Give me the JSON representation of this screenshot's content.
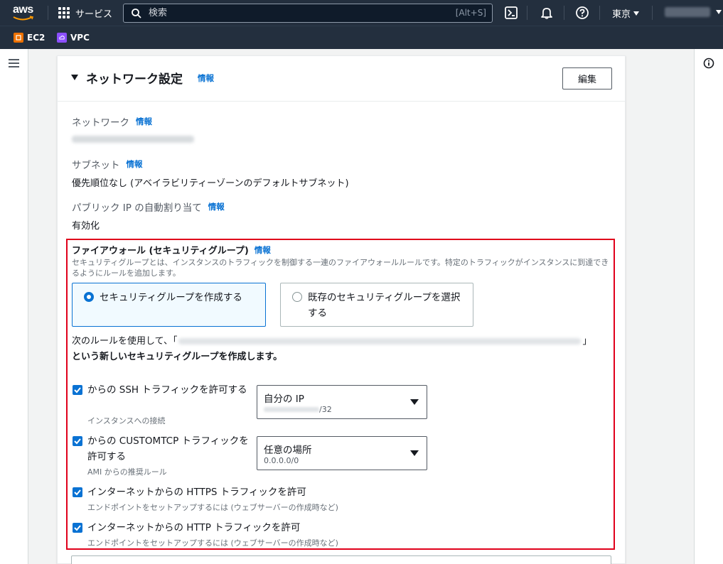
{
  "topnav": {
    "logo_text": "aws",
    "services_label": "サービス",
    "search_placeholder": "検索",
    "search_shortcut": "[Alt+S]",
    "region_label": "東京"
  },
  "favorites": [
    {
      "label": "EC2",
      "color": "#ed7100"
    },
    {
      "label": "VPC",
      "color": "#8c4fff"
    }
  ],
  "panel": {
    "title": "ネットワーク設定",
    "info_label": "情報",
    "edit_label": "編集",
    "fields": {
      "network_label": "ネットワーク",
      "subnet_label": "サブネット",
      "subnet_value": "優先順位なし (アベイラビリティーゾーンのデフォルトサブネット)",
      "public_ip_label": "パブリック IP の自動割り当て",
      "public_ip_value": "有効化"
    },
    "firewall": {
      "title": "ファイアウォール (セキュリティグループ)",
      "description": "セキュリティグループとは、インスタンスのトラフィックを制御する一連のファイアウォールルールです。特定のトラフィックがインスタンスに到達できるようにルールを追加します。",
      "option_create": "セキュリティグループを作成する",
      "option_existing": "既存のセキュリティグループを選択する",
      "rule_prefix": "次のルールを使用して、「",
      "rule_suffix": "」",
      "rule_line2": "という新しいセキュリティグループを作成します。",
      "rules": [
        {
          "label": "からの SSH トラフィックを許可する",
          "sub": "インスタンスへの接続",
          "select_main": "自分の IP",
          "select_sub": "/32"
        },
        {
          "label": "からの CUSTOMTCP トラフィックを許可する",
          "sub": "AMI からの推奨ルール",
          "select_main": "任意の場所",
          "select_sub": "0.0.0.0/0"
        },
        {
          "label": "インターネットからの HTTPS トラフィックを許可",
          "sub": "エンドポイントをセットアップするには (ウェブサーバーの作成時など)"
        },
        {
          "label": "インターネットからの HTTP トラフィックを許可",
          "sub": "エンドポイントをセットアップするには (ウェブサーバーの作成時など)"
        }
      ]
    }
  },
  "colors": {
    "nav_bg": "#232f3e",
    "link": "#0972d3",
    "highlight": "#e0001b"
  }
}
